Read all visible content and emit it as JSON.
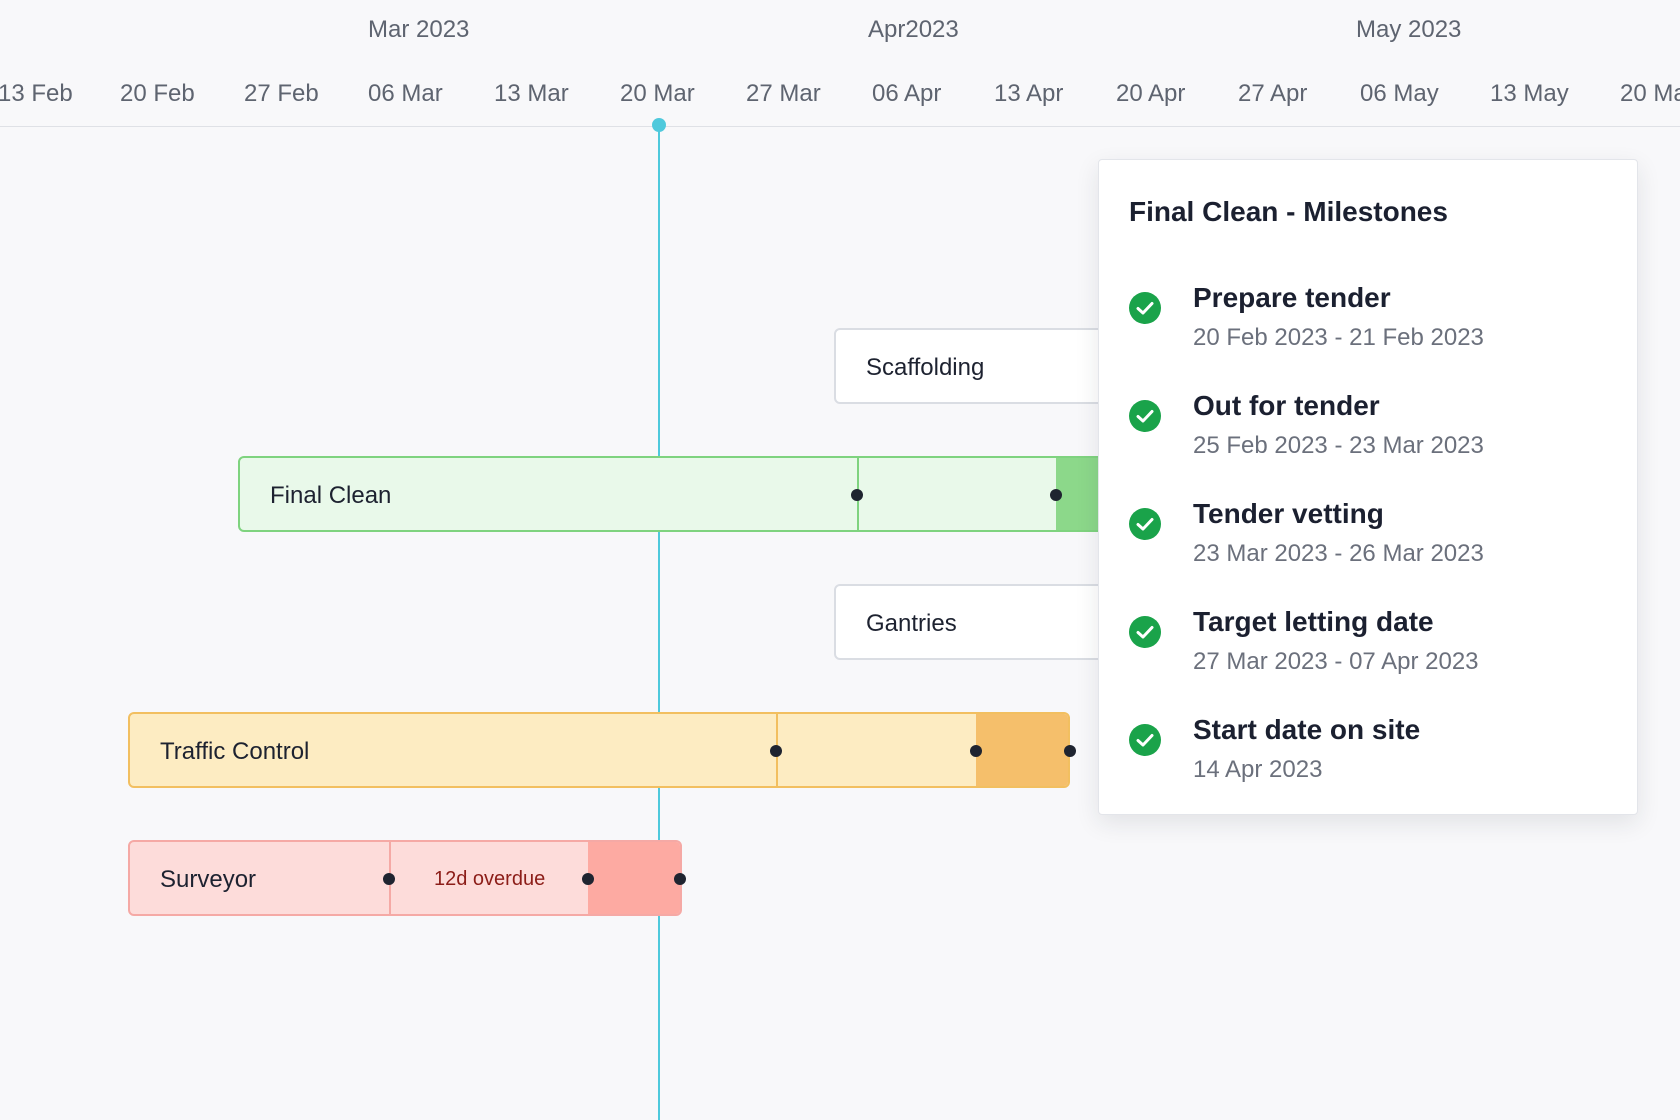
{
  "timeline": {
    "months": [
      "Mar 2023",
      "Apr2023",
      "May 2023"
    ],
    "weeks": [
      "13 Feb",
      "20 Feb",
      "27 Feb",
      "06 Mar",
      "13 Mar",
      "20 Mar",
      "27 Mar",
      "06 Apr",
      "13 Apr",
      "20 Apr",
      "27 Apr",
      "06 May",
      "13 May",
      "20 Ma"
    ],
    "today": "20 Mar"
  },
  "colors": {
    "today_line": "#4fc9dc",
    "green_fill": "#e9f9ea",
    "green_border": "#7fd37f",
    "green_overrun": "#8cd88a",
    "orange_fill": "#fdecc2",
    "orange_border": "#f2bf60",
    "orange_overrun": "#f5bf6b",
    "red_fill": "#fddcda",
    "red_border": "#f5a9a5",
    "red_overrun": "#fdaaa2",
    "check": "#1aa34a"
  },
  "tasks": [
    {
      "label": "Scaffolding"
    },
    {
      "label": "Final Clean"
    },
    {
      "label": "Gantries"
    },
    {
      "label": "Traffic Control"
    },
    {
      "label": "Surveyor",
      "status": "12d overdue"
    }
  ],
  "popover": {
    "title": "Final Clean - Milestones",
    "milestones": [
      {
        "name": "Prepare tender",
        "dates": "20 Feb 2023 - 21 Feb 2023",
        "icon": "check-circle-icon"
      },
      {
        "name": "Out for tender",
        "dates": "25 Feb 2023 - 23 Mar 2023",
        "icon": "check-circle-icon"
      },
      {
        "name": "Tender vetting",
        "dates": "23 Mar 2023 - 26 Mar 2023",
        "icon": "check-circle-icon"
      },
      {
        "name": "Target letting date",
        "dates": "27 Mar 2023 - 07 Apr 2023",
        "icon": "check-circle-icon"
      },
      {
        "name": "Start date on site",
        "dates": "14 Apr 2023",
        "icon": "check-circle-icon"
      }
    ]
  }
}
